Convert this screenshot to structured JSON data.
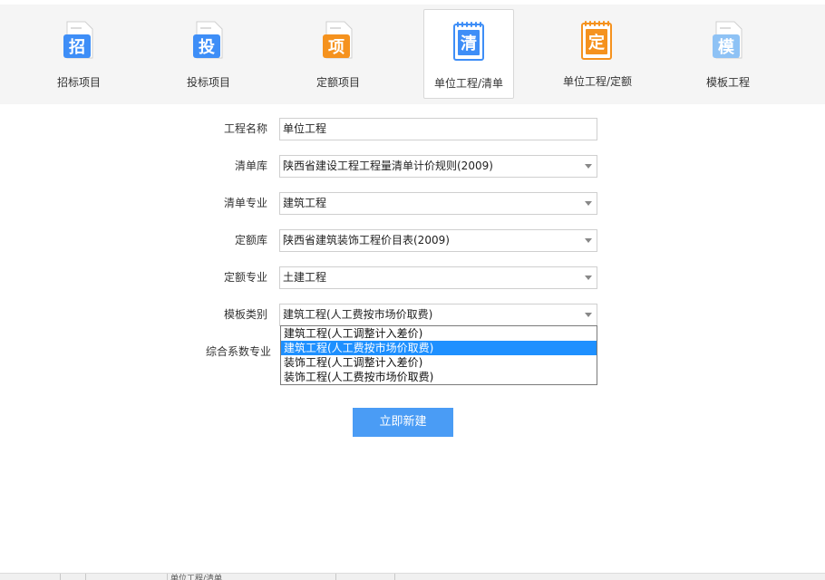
{
  "toolbar": {
    "items": [
      {
        "label": "招标项目",
        "glyph": "招",
        "color": "#3e8ef7",
        "icon": "bid-doc-icon"
      },
      {
        "label": "投标项目",
        "glyph": "投",
        "color": "#3e8ef7",
        "icon": "tender-doc-icon"
      },
      {
        "label": "定额项目",
        "glyph": "项",
        "color": "#f5921e",
        "icon": "quota-project-doc-icon"
      },
      {
        "label": "单位工程/清单",
        "glyph": "清",
        "color": "#3e8ef7",
        "icon": "bill-notebook-icon",
        "active": true
      },
      {
        "label": "单位工程/定额",
        "glyph": "定",
        "color": "#f5921e",
        "icon": "quota-notebook-icon"
      },
      {
        "label": "模板工程",
        "glyph": "模",
        "color": "#8ec2f5",
        "icon": "template-doc-icon"
      }
    ]
  },
  "form": {
    "name_label": "工程名称",
    "name_value": "单位工程",
    "bill_lib_label": "清单库",
    "bill_lib_value": "陕西省建设工程工程量清单计价规则(2009)",
    "bill_major_label": "清单专业",
    "bill_major_value": "建筑工程",
    "quota_lib_label": "定额库",
    "quota_lib_value": "陕西省建筑装饰工程价目表(2009)",
    "quota_major_label": "定额专业",
    "quota_major_value": "土建工程",
    "template_label": "模板类别",
    "template_value": "建筑工程(人工费按市场价取费)",
    "coef_label": "综合系数专业",
    "template_options": [
      "建筑工程(人工调整计入差价)",
      "建筑工程(人工费按市场价取费)",
      "装饰工程(人工调整计入差价)",
      "装饰工程(人工费按市场价取费)"
    ],
    "selected_option": 1,
    "create_label": "立即新建"
  },
  "bottom": {
    "fragment": "单位工程/清单"
  }
}
